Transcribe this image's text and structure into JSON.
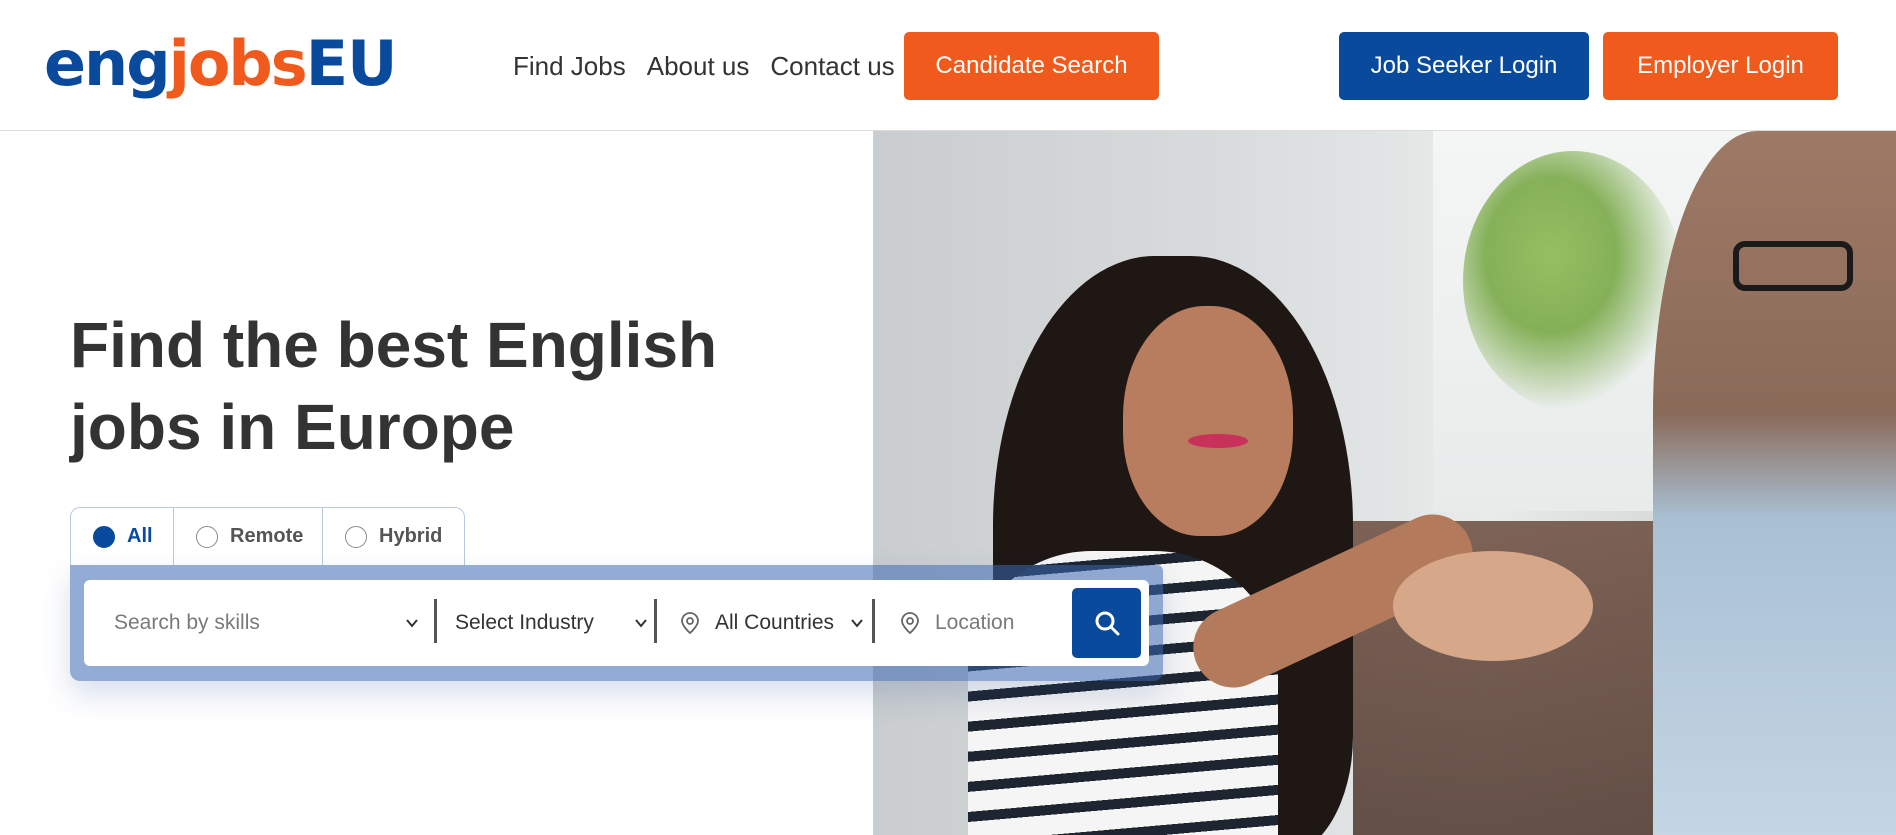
{
  "header": {
    "logo": {
      "part1": "eng",
      "part2": "jobs",
      "part3": "EU"
    },
    "nav": [
      {
        "label": "Find Jobs"
      },
      {
        "label": "About us"
      },
      {
        "label": "Contact us"
      }
    ],
    "candidate_search_label": "Candidate Search",
    "job_seeker_login_label": "Job Seeker Login",
    "employer_login_label": "Employer Login"
  },
  "hero": {
    "headline_line1": "Find the best English",
    "headline_line2": "jobs in Europe",
    "image_icon": "hero-photo-handshake"
  },
  "search": {
    "tabs": [
      {
        "label": "All",
        "selected": true
      },
      {
        "label": "Remote",
        "selected": false
      },
      {
        "label": "Hybrid",
        "selected": false
      }
    ],
    "skills_placeholder": "Search by skills",
    "industry_value": "Select Industry",
    "countries_value": "All Countries",
    "location_placeholder": "Location",
    "search_icon": "search-icon"
  },
  "colors": {
    "brand_blue": "#0a4a9c",
    "brand_orange": "#f05a1c",
    "text_dark": "#333333"
  }
}
